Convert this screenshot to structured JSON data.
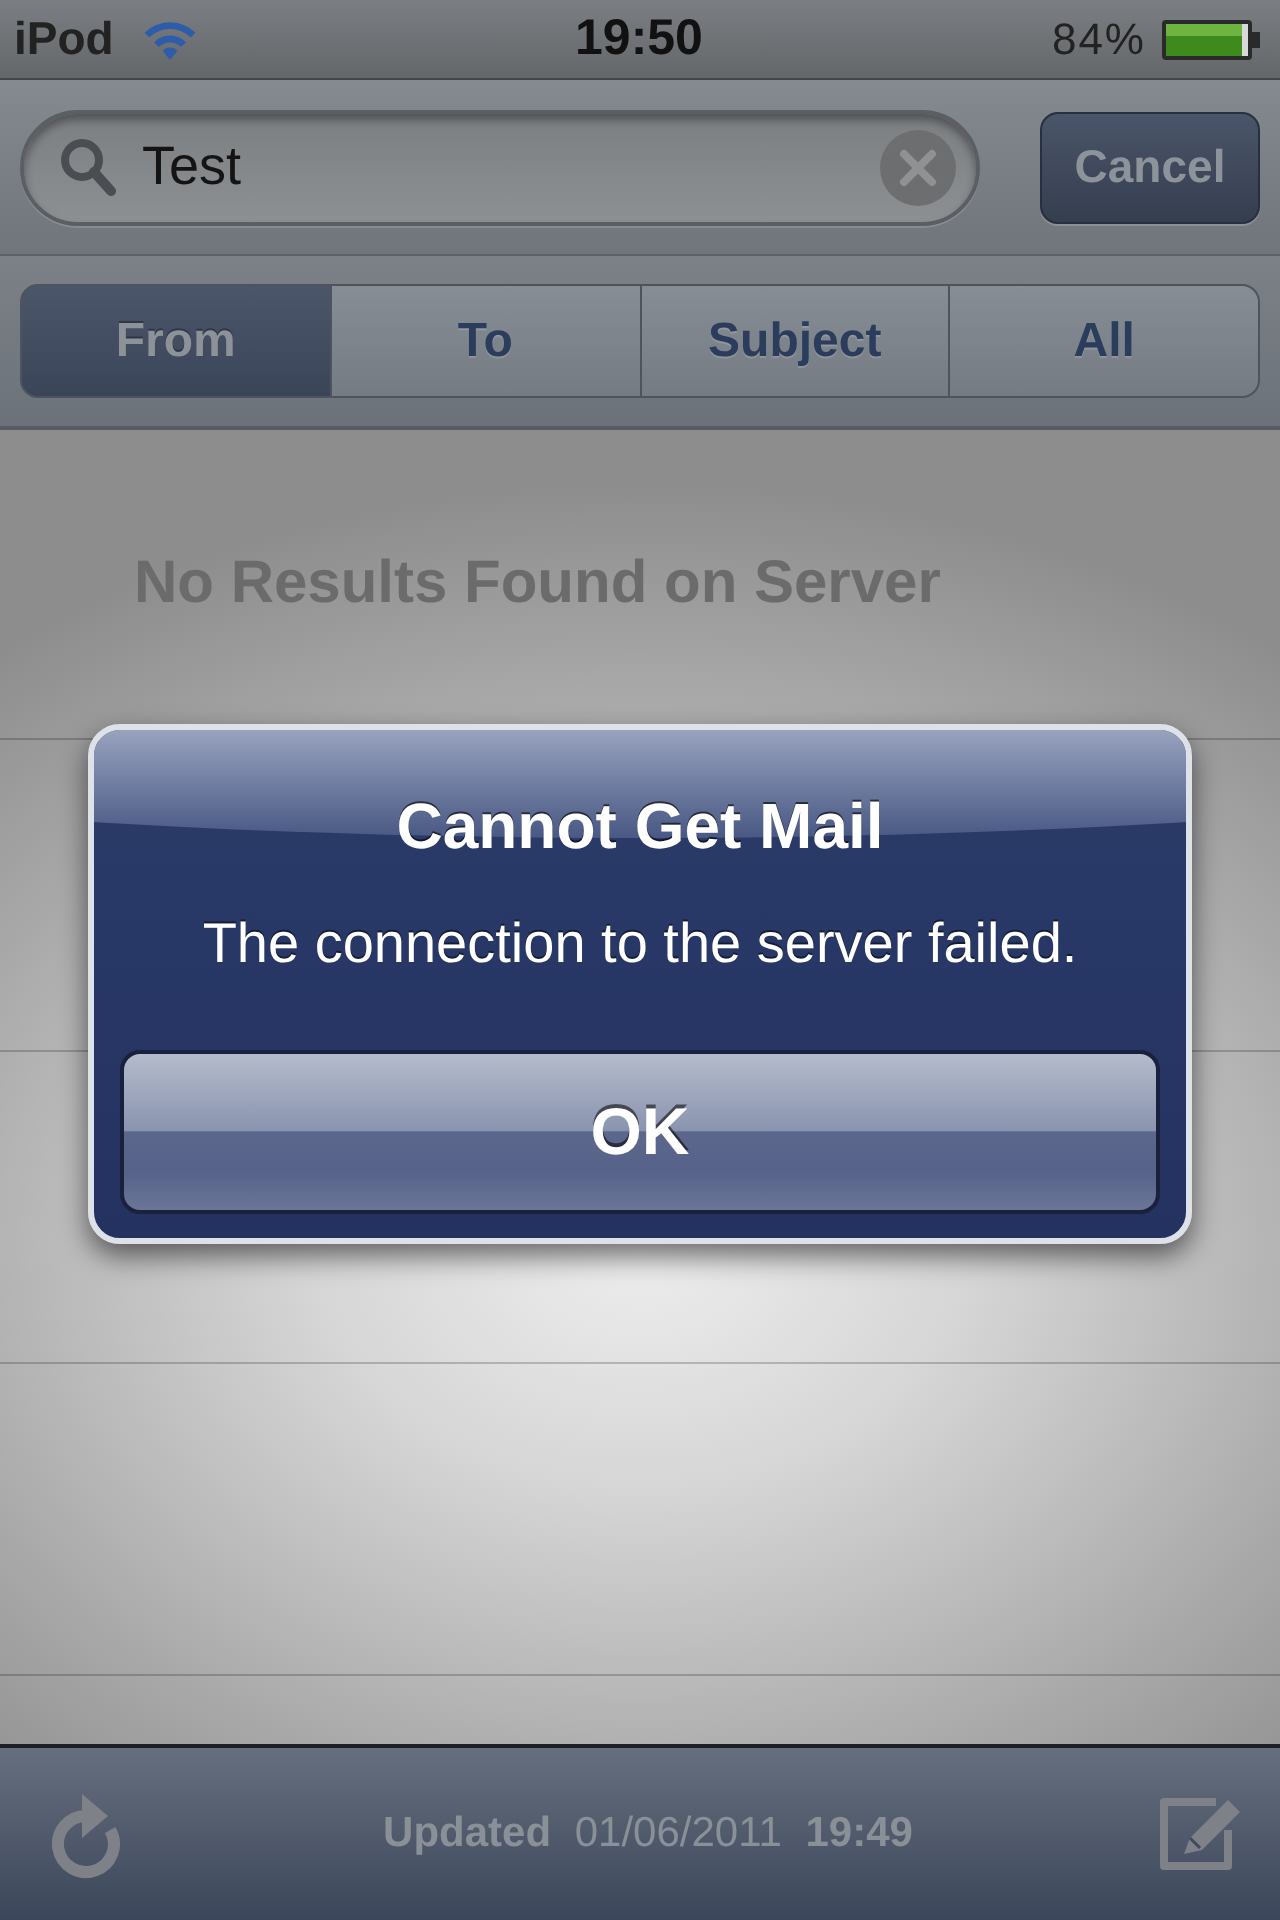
{
  "status_bar": {
    "carrier": "iPod",
    "time": "19:50",
    "battery": "84%"
  },
  "search": {
    "value": "Test",
    "cancel_button": "Cancel"
  },
  "scope_tabs": [
    {
      "label": "From",
      "selected": true
    },
    {
      "label": "To",
      "selected": false
    },
    {
      "label": "Subject",
      "selected": false
    },
    {
      "label": "All",
      "selected": false
    }
  ],
  "results": {
    "message": "No Results Found on Server"
  },
  "alert": {
    "title": "Cannot Get Mail",
    "message": "The connection to the server failed.",
    "buttons": [
      "OK"
    ]
  },
  "toolbar": {
    "status": "**Updated** 01/06/2011 **19:49**"
  }
}
